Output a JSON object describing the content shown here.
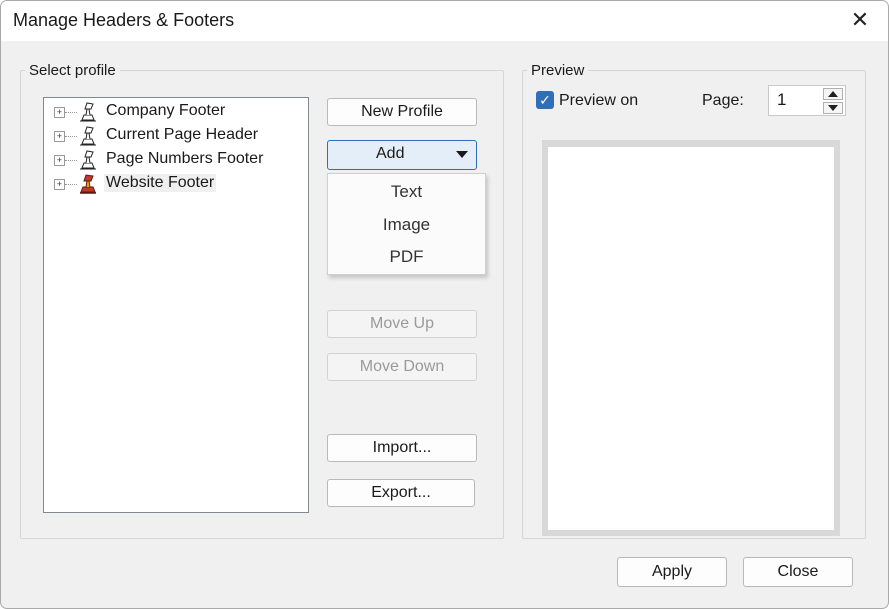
{
  "window": {
    "title": "Manage Headers & Footers"
  },
  "select_profile": {
    "label": "Select profile",
    "items": [
      {
        "label": "Company Footer",
        "icon": "stamp-icon"
      },
      {
        "label": "Current Page Header",
        "icon": "stamp-icon"
      },
      {
        "label": "Page Numbers Footer",
        "icon": "stamp-icon"
      },
      {
        "label": "Website Footer",
        "icon": "stamp-red-icon"
      }
    ]
  },
  "buttons": {
    "new_profile": "New Profile",
    "add": "Add",
    "move_up": "Move Up",
    "move_down": "Move Down",
    "import": "Import...",
    "export": "Export...",
    "apply": "Apply",
    "close": "Close"
  },
  "add_menu": {
    "items": [
      "Text",
      "Image",
      "PDF"
    ]
  },
  "preview": {
    "label": "Preview",
    "preview_on_label": "Preview on",
    "page_label": "Page:",
    "page_value": "1"
  },
  "colors": {
    "accent": "#2f6fb8",
    "stamp_red": "#c0392b"
  }
}
